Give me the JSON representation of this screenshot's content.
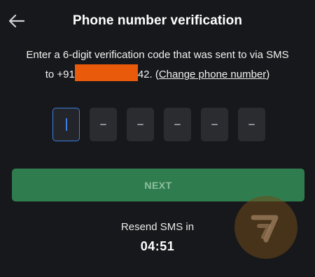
{
  "header": {
    "back_icon": "arrow-left-icon",
    "title": "Phone number verification"
  },
  "message": {
    "line1": "Enter a 6-digit verification code that was sent to via SMS",
    "line2_prefix": "to +91",
    "line2_suffix": "42. (",
    "change_link": "Change phone number",
    "line2_close": ")"
  },
  "otp": {
    "digits": 6,
    "active_index": 0
  },
  "next_button": {
    "label": "NEXT"
  },
  "resend": {
    "label": "Resend SMS in",
    "timer": "04:51"
  },
  "colors": {
    "background": "#17181b",
    "accent_green": "#2f7d4f",
    "focus_blue": "#3d7fe0",
    "redaction_orange": "#ea5a0b"
  }
}
